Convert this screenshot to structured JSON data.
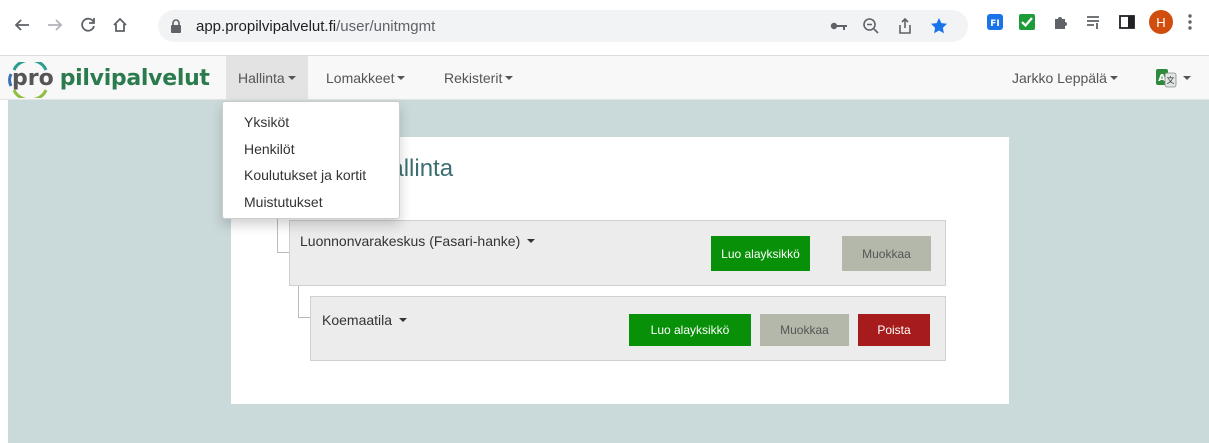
{
  "browser": {
    "url_host": "app.propilvipalvelut.fi",
    "url_path": "/user/unitmgmt",
    "profile_initial": "H",
    "extension_badge": "FI"
  },
  "navbar": {
    "logo_prefix": "pro",
    "logo_word": "pilvipalvelut",
    "menus": [
      {
        "label": "Hallinta",
        "active": true
      },
      {
        "label": "Lomakkeet",
        "active": false
      },
      {
        "label": "Rekisterit",
        "active": false
      }
    ],
    "user_name": "Jarkko Leppälä",
    "language_icon": "translate-icon"
  },
  "dropdown": {
    "items": [
      "Yksiköt",
      "Henkilöt",
      "Koulutukset ja kortit",
      "Muistutukset"
    ]
  },
  "page": {
    "title_visible": "hallinta"
  },
  "units": [
    {
      "name": "Luonnonvarakeskus (Fasari-hanke)",
      "buttons": {
        "create": "Luo alayksikkö",
        "edit": "Muokkaa"
      }
    },
    {
      "name": "Koemaatila",
      "buttons": {
        "create": "Luo alayksikkö",
        "edit": "Muokkaa",
        "delete": "Poista"
      }
    }
  ],
  "colors": {
    "background": "#cad9da",
    "brand_green": "#2c7b4f",
    "button_green": "#089008",
    "button_gray": "#b3b8ab",
    "button_red": "#a61c1c",
    "title": "#3c6e71"
  }
}
